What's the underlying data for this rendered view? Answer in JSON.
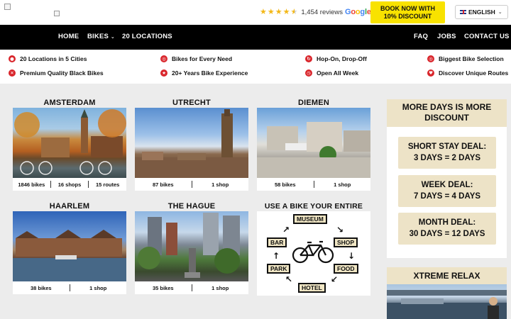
{
  "header": {
    "rating": {
      "stars": 4.5,
      "reviews_text": "1,454 reviews",
      "google": [
        "G",
        "o",
        "o",
        "g",
        "l",
        "e"
      ]
    },
    "book_button": {
      "line1": "BOOK NOW WITH",
      "line2": "10% DISCOUNT"
    },
    "language": "ENGLISH"
  },
  "nav": {
    "left": [
      "HOME",
      "BIKES",
      "20 LOCATIONS"
    ],
    "right": [
      "FAQ",
      "JOBS",
      "CONTACT US"
    ]
  },
  "features": [
    "20 Locations in 5 Cities",
    "Bikes for Every Need",
    "Hop-On, Drop-Off",
    "Biggest Bike Selection",
    "Premium Quality Black Bikes",
    "20+ Years Bike Experience",
    "Open All Week",
    "Discover Unique Routes"
  ],
  "locations": [
    {
      "name": "AMSTERDAM",
      "stats": [
        "1846 bikes",
        "16 shops",
        "15 routes"
      ]
    },
    {
      "name": "UTRECHT",
      "stats": [
        "87 bikes",
        "1 shop"
      ]
    },
    {
      "name": "DIEMEN",
      "stats": [
        "58 bikes",
        "1 shop"
      ]
    },
    {
      "name": "HAARLEM",
      "stats": [
        "38 bikes",
        "1 shop"
      ]
    },
    {
      "name": "THE HAGUE",
      "stats": [
        "35 bikes",
        "1 shop"
      ]
    }
  ],
  "bike_usage": {
    "title": "USE A BIKE YOUR ENTIRE STAY",
    "labels": [
      "MUSEUM",
      "SHOP",
      "FOOD",
      "HOTEL",
      "PARK",
      "BAR"
    ]
  },
  "discount": {
    "title_line1": "MORE DAYS IS MORE",
    "title_line2": "DISCOUNT",
    "deals": [
      {
        "line1": "SHORT STAY DEAL:",
        "line2": "3 DAYS = 2 DAYS"
      },
      {
        "line1": "WEEK DEAL:",
        "line2": "7 DAYS = 4 DAYS"
      },
      {
        "line1": "MONTH DEAL:",
        "line2": "30 DAYS = 12 DAYS"
      }
    ]
  },
  "xtreme": {
    "title": "XTREME RELAX"
  },
  "colors": {
    "accent_red": "#d9252b",
    "cta_yellow": "#f8e200",
    "beige": "#ede3c7",
    "nav_black": "#000000"
  }
}
